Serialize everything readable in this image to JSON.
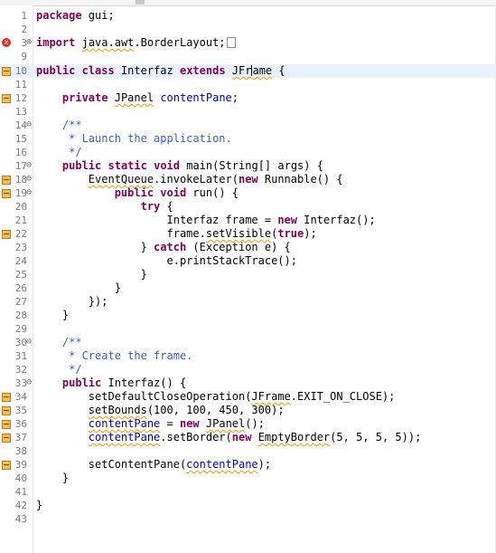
{
  "editor": {
    "lines": [
      {
        "n": "1",
        "text": "package gui;"
      },
      {
        "n": "2",
        "text": ""
      },
      {
        "n": "3",
        "text": "import java.awt.BorderLayout;"
      },
      {
        "n": "9",
        "text": ""
      },
      {
        "n": "10",
        "text": "public class Interfaz extends JFrame {"
      },
      {
        "n": "11",
        "text": ""
      },
      {
        "n": "12",
        "text": "    private JPanel contentPane;"
      },
      {
        "n": "13",
        "text": ""
      },
      {
        "n": "14",
        "text": "    /**"
      },
      {
        "n": "15",
        "text": "     * Launch the application."
      },
      {
        "n": "16",
        "text": "     */"
      },
      {
        "n": "17",
        "text": "    public static void main(String[] args) {"
      },
      {
        "n": "18",
        "text": "        EventQueue.invokeLater(new Runnable() {"
      },
      {
        "n": "19",
        "text": "            public void run() {"
      },
      {
        "n": "20",
        "text": "                try {"
      },
      {
        "n": "21",
        "text": "                    Interfaz frame = new Interfaz();"
      },
      {
        "n": "22",
        "text": "                    frame.setVisible(true);"
      },
      {
        "n": "23",
        "text": "                } catch (Exception e) {"
      },
      {
        "n": "24",
        "text": "                    e.printStackTrace();"
      },
      {
        "n": "25",
        "text": "                }"
      },
      {
        "n": "26",
        "text": "            }"
      },
      {
        "n": "27",
        "text": "        });"
      },
      {
        "n": "28",
        "text": "    }"
      },
      {
        "n": "29",
        "text": ""
      },
      {
        "n": "30",
        "text": "    /**"
      },
      {
        "n": "31",
        "text": "     * Create the frame."
      },
      {
        "n": "32",
        "text": "     */"
      },
      {
        "n": "33",
        "text": "    public Interfaz() {"
      },
      {
        "n": "34",
        "text": "        setDefaultCloseOperation(JFrame.EXIT_ON_CLOSE);"
      },
      {
        "n": "35",
        "text": "        setBounds(100, 100, 450, 300);"
      },
      {
        "n": "36",
        "text": "        contentPane = new JPanel();"
      },
      {
        "n": "37",
        "text": "        contentPane.setBorder(new EmptyBorder(5, 5, 5, 5));"
      },
      {
        "n": "38",
        "text": ""
      },
      {
        "n": "39",
        "text": "        setContentPane(contentPane);"
      },
      {
        "n": "40",
        "text": "    }"
      },
      {
        "n": "41",
        "text": ""
      },
      {
        "n": "42",
        "text": "}"
      },
      {
        "n": "43",
        "text": ""
      }
    ]
  }
}
